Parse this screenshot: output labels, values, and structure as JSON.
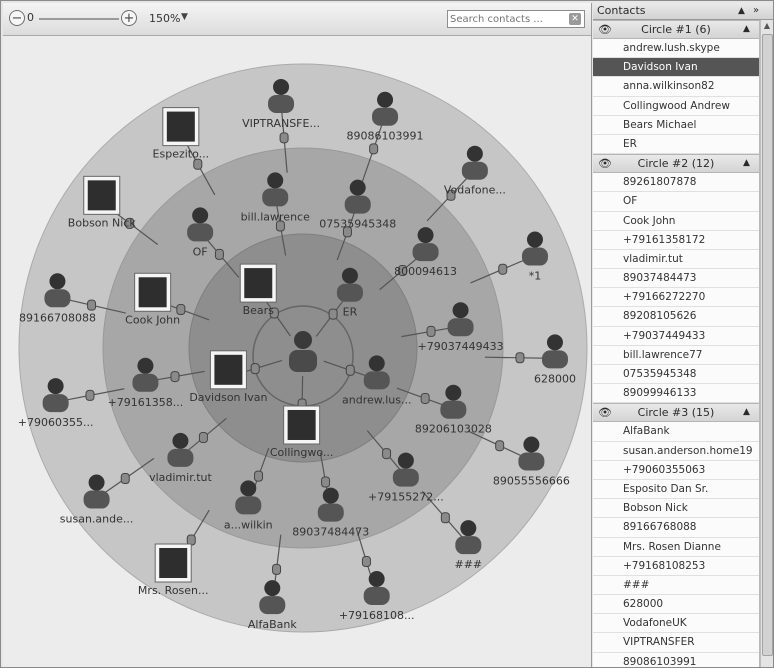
{
  "toolbar": {
    "zoom_min_label": "0",
    "zoom_value": "150%",
    "search_placeholder": "Search contacts ..."
  },
  "graph": {
    "center_label": "",
    "ring_labels": {
      "inner": [
        "Bears",
        "ER",
        "andrew.lus...",
        "Collingwo...",
        "Davidson Ivan"
      ],
      "middle": [
        "bill.lawrence",
        "07535945348",
        "800094613",
        "+79037449433",
        "89206103028",
        "+79155272...",
        "89037484473",
        "a...wilkin",
        "vladimir.tut",
        "+79161358...",
        "Cook John",
        "OF"
      ],
      "outer": [
        "VIPTRANSFE...",
        "89086103991",
        "Vodafone...",
        "*1",
        "628000",
        "89055556666",
        "###",
        "+79168108...",
        "AlfaBank",
        "Mrs. Rosen...",
        "susan.ande...",
        "+79060355...",
        "89166708088",
        "Bobson Nick",
        "Espezito..."
      ]
    }
  },
  "contacts": {
    "title": "Contacts",
    "circles": [
      {
        "title": "Circle #1 (6)",
        "items": [
          "andrew.lush.skype",
          "Davidson Ivan",
          "anna.wilkinson82",
          "Collingwood Andrew",
          "Bears Michael",
          "ER"
        ]
      },
      {
        "title": "Circle #2 (12)",
        "items": [
          "89261807878",
          "OF",
          "Cook John",
          "+79161358172",
          "vladimir.tut",
          "89037484473",
          "+79166272270",
          "89208105626",
          "+79037449433",
          "bill.lawrence77",
          "07535945348",
          "89099946133"
        ]
      },
      {
        "title": "Circle #3 (15)",
        "items": [
          "AlfaBank",
          "susan.anderson.home19",
          "+79060355063",
          "Esposito Dan  Sr.",
          "Bobson Nick",
          "89166768088",
          "Mrs. Rosen Dianne",
          "+79168108253",
          "###",
          "628000",
          "VodafoneUK",
          "VIPTRANSFER",
          "89086103991"
        ]
      }
    ],
    "selected_item": "Davidson Ivan"
  }
}
